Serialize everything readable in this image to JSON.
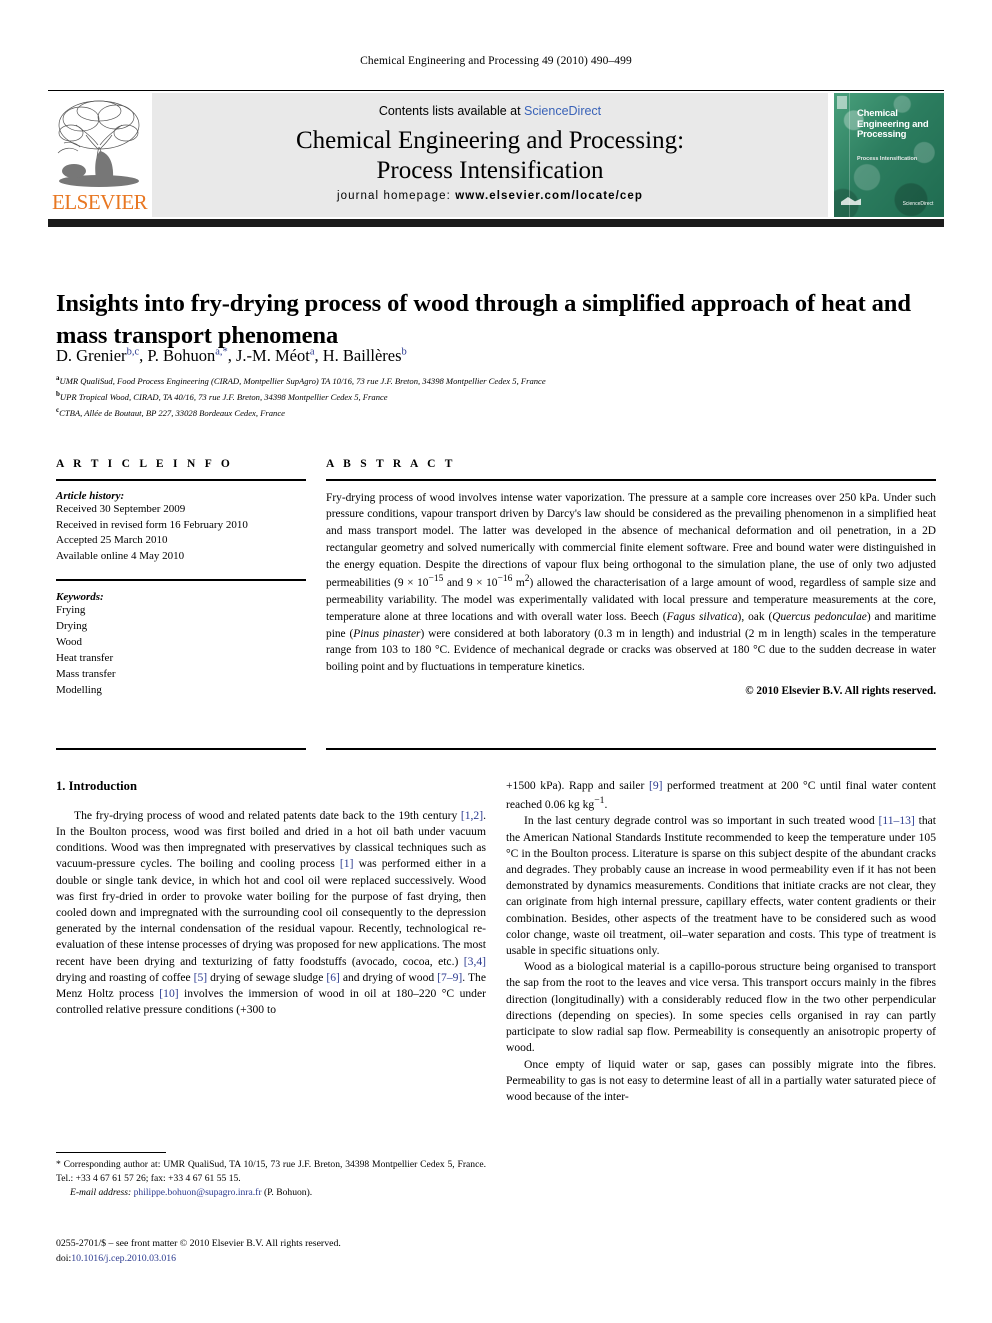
{
  "running_head": "Chemical Engineering and Processing 49 (2010) 490–499",
  "masthead": {
    "contents_prefix": "Contents lists available at ",
    "sciencedirect": "ScienceDirect",
    "journal_title_line1": "Chemical Engineering and Processing:",
    "journal_title_line2": "Process Intensification",
    "homepage_label": "journal homepage:",
    "homepage_url": "www.elsevier.com/locate/cep",
    "publisher_logo_text": "ELSEVIER",
    "publisher_accent_color": "#E87722",
    "cover": {
      "title": "Chemical Engineering and Processing",
      "subtitle": "Process Intensification",
      "badge": "ScienceDirect",
      "accent_color": "#2e8464"
    }
  },
  "article": {
    "title": "Insights into fry-drying process of wood through a simplified approach of heat and mass transport phenomena",
    "authors_html": "D. Grenier<sup>b,c</sup>, P. Bohuon<sup>a,*</sup>, J.-M. Méot<sup>a</sup>, H. Baillères<sup>b</sup>",
    "affiliations": [
      {
        "marker": "a",
        "text": "UMR QualiSud, Food Process Engineering (CIRAD, Montpellier SupAgro) TA 10/16, 73 rue J.F. Breton, 34398 Montpellier Cedex 5, France"
      },
      {
        "marker": "b",
        "text": "UPR Tropical Wood, CIRAD, TA 40/16, 73 rue J.F. Breton, 34398 Montpellier Cedex 5, France"
      },
      {
        "marker": "c",
        "text": "CTBA, Allée de Boutaut, BP 227, 33028 Bordeaux Cedex, France"
      }
    ]
  },
  "article_info": {
    "heading": "A R T I C L E   I N F O",
    "history_label": "Article history:",
    "history": [
      "Received 30 September 2009",
      "Received in revised form 16 February 2010",
      "Accepted 25 March 2010",
      "Available online 4 May 2010"
    ],
    "keywords_label": "Keywords:",
    "keywords": [
      "Frying",
      "Drying",
      "Wood",
      "Heat transfer",
      "Mass transfer",
      "Modelling"
    ]
  },
  "abstract": {
    "heading": "A B S T R A C T",
    "body_html": "Fry-drying process of wood involves intense water vaporization. The pressure at a sample core increases over 250 kPa. Under such pressure conditions, vapour transport driven by Darcy's law should be considered as the prevailing phenomenon in a simplified heat and mass transport model. The latter was developed in the absence of mechanical deformation and oil penetration, in a 2D rectangular geometry and solved numerically with commercial finite element software. Free and bound water were distinguished in the energy equation. Despite the directions of vapour flux being orthogonal to the simulation plane, the use of only two adjusted permeabilities (9 &#215; 10<sup>&#8722;15</sup> and 9 &#215; 10<sup>&#8722;16</sup> m<sup>2</sup>) allowed the characterisation of a large amount of wood, regardless of sample size and permeability variability. The model was experimentally validated with local pressure and temperature measurements at the core, temperature alone at three locations and with overall water loss. Beech (<i>Fagus silvatica</i>), oak (<i>Quercus pedonculae</i>) and maritime pine (<i>Pinus pinaster</i>) were considered at both laboratory (0.3 m in length) and industrial (2 m in length) scales in the temperature range from 103 to 180 &#176;C. Evidence of mechanical degrade or cracks was observed at 180 &#176;C due to the sudden decrease in water boiling point and by fluctuations in temperature kinetics.",
    "copyright": "© 2010 Elsevier B.V. All rights reserved."
  },
  "introduction": {
    "section_title": "1.  Introduction",
    "left_paragraphs_html": [
      "The fry-drying process of wood and related patents date back to the 19th century <span class=\"ref\">[1,2]</span>. In the Boulton process, wood was first boiled and dried in a hot oil bath under vacuum conditions. Wood was then impregnated with preservatives by classical techniques such as vacuum-pressure cycles. The boiling and cooling process <span class=\"ref\">[1]</span> was performed either in a double or single tank device, in which hot and cool oil were replaced successively. Wood was first fry-dried in order to provoke water boiling for the purpose of fast drying, then cooled down and impregnated with the surrounding cool oil consequently to the depression generated by the internal condensation of the residual vapour. Recently, technological re-evaluation of these intense processes of drying was proposed for new applications. The most recent have been drying and texturizing of fatty foodstuffs (avocado, cocoa, etc.) <span class=\"ref\">[3,4]</span> drying and roasting of coffee <span class=\"ref\">[5]</span> drying of sewage sludge <span class=\"ref\">[6]</span> and drying of wood <span class=\"ref\">[7&#8211;9]</span>. The Menz Holtz process <span class=\"ref\">[10]</span> involves the immersion of wood in oil at 180&#8211;220 &#176;C under controlled relative pressure conditions (+300 to"
    ],
    "right_paragraphs_html": [
      "+1500 kPa). Rapp and sailer <span class=\"ref\">[9]</span> performed treatment at 200 &#176;C until final water content reached 0.06 kg kg<sup>&#8722;1</sup>.",
      "In the last century degrade control was so important in such treated wood <span class=\"ref\">[11&#8211;13]</span> that the American National Standards Institute recommended to keep the temperature under 105 &#176;C in the Boulton process. Literature is sparse on this subject despite of the abundant cracks and degrades. They probably cause an increase in wood permeability even if it has not been demonstrated by dynamics measurements. Conditions that initiate cracks are not clear, they can originate from high internal pressure, capillary effects, water content gradients or their combination. Besides, other aspects of the treatment have to be considered such as wood color change, waste oil treatment, oil&#8211;water separation and costs. This type of treatment is usable in specific situations only.",
      "Wood as a biological material is a capillo-porous structure being organised to transport the sap from the root to the leaves and vice versa. This transport occurs mainly in the fibres direction (longitudinally) with a considerably reduced flow in the two other perpendicular directions (depending on species). In some species cells organised in ray can partly participate to slow radial sap flow. Permeability is consequently an anisotropic property of wood.",
      "Once empty of liquid water or sap, gases can possibly migrate into the fibres. Permeability to gas is not easy to determine least of all in a partially water saturated piece of wood because of the inter-"
    ]
  },
  "footer": {
    "corresponding_html": "* Corresponding author at: UMR QualiSud, TA 10/15, 73 rue J.F. Breton, 34398 Montpellier Cedex 5, France. Tel.: +33 4 67 61 57 26; fax: +33 4 67 61 55 15.",
    "email_label": "E-mail address:",
    "email": "philippe.bohuon@supagro.inra.fr",
    "email_suffix": "(P. Bohuon).",
    "issn_line": "0255-2701/$ – see front matter © 2010 Elsevier B.V. All rights reserved.",
    "doi_label": "doi:",
    "doi": "10.1016/j.cep.2010.03.016"
  }
}
